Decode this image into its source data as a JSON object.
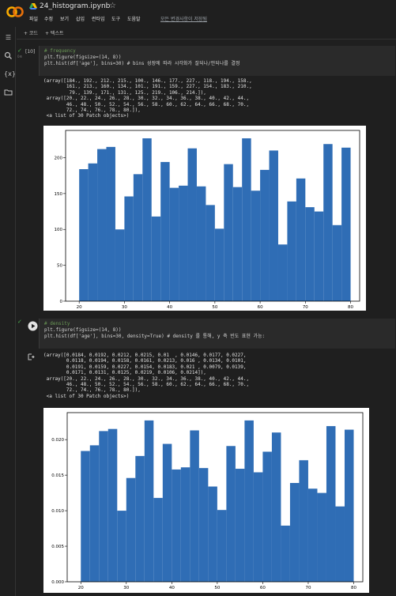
{
  "app": {
    "title": "24_histogram.ipynb",
    "star_icon": "☆",
    "menu": [
      "파일",
      "수정",
      "보기",
      "삽입",
      "런타임",
      "도구",
      "도움말"
    ],
    "saved_status": "모든 변경사항이 저장됨"
  },
  "sidebar": {
    "icons": [
      "menu-icon",
      "search-icon",
      "code-icon",
      "folder-icon"
    ]
  },
  "toolbar": {
    "add_code": "+ 코드",
    "add_text": "+ 텍스트"
  },
  "cell1": {
    "exec_count": "[10]",
    "exec_time": "0초",
    "code": [
      "# frequency",
      "plt.figure(figsize=(14, 8))",
      "plt.hist(df['age'], bins=30) # bins 성장에 따라 시각화가 잘되나/안되나를 결정"
    ],
    "output": [
      "(array([184., 192., 212., 215., 100., 146., 177., 227., 118., 194., 158.,",
      "        161., 213., 160., 134., 101., 191., 159., 227., 154., 183., 210.,",
      "         79., 139., 171., 131., 125., 219., 106., 214.]),",
      " array([20., 22., 24., 26., 28., 30., 32., 34., 36., 38., 40., 42., 44.,",
      "        46., 48., 50., 52., 54., 56., 58., 60., 62., 64., 66., 68., 70.,",
      "        72., 74., 76., 78., 80.]),",
      " <a list of 30 Patch objects>)"
    ]
  },
  "cell2": {
    "code": [
      "# density",
      "plt.figure(figsize=(14, 8))",
      "plt.hist(df['age'], bins=30, density=True) # density 를 통해, y 축 빈도 표현 가능:"
    ],
    "output": [
      "(array([0.0184, 0.0192, 0.0212, 0.0215, 0.01  , 0.0146, 0.0177, 0.0227,",
      "        0.0118, 0.0194, 0.0158, 0.0161, 0.0213, 0.016 , 0.0134, 0.0101,",
      "        0.0191, 0.0159, 0.0227, 0.0154, 0.0183, 0.021 , 0.0079, 0.0139,",
      "        0.0171, 0.0131, 0.0125, 0.0219, 0.0106, 0.0214]),",
      " array([20., 22., 24., 26., 28., 30., 32., 34., 36., 38., 40., 42., 44.,",
      "        46., 48., 50., 52., 54., 56., 58., 60., 62., 64., 66., 68., 70.,",
      "        72., 74., 76., 78., 80.]),",
      " <a list of 30 Patch objects>)"
    ]
  },
  "chart_data": [
    {
      "type": "bar",
      "title": "",
      "xlabel": "",
      "ylabel": "",
      "bin_edges": [
        20,
        22,
        24,
        26,
        28,
        30,
        32,
        34,
        36,
        38,
        40,
        42,
        44,
        46,
        48,
        50,
        52,
        54,
        56,
        58,
        60,
        62,
        64,
        66,
        68,
        70,
        72,
        74,
        76,
        78,
        80
      ],
      "values": [
        184,
        192,
        212,
        215,
        100,
        146,
        177,
        227,
        118,
        194,
        158,
        161,
        213,
        160,
        134,
        101,
        191,
        159,
        227,
        154,
        183,
        210,
        79,
        139,
        171,
        131,
        125,
        219,
        106,
        214
      ],
      "xlim": [
        17,
        82
      ],
      "ylim": [
        0,
        238
      ],
      "xticks": [
        20,
        30,
        40,
        50,
        60,
        70,
        80
      ],
      "yticks": [
        0,
        50,
        100,
        150,
        200
      ],
      "ytick_labels": [
        "0",
        "50",
        "100",
        "150",
        "200"
      ],
      "bar_color": "#2f6db5",
      "grid": false
    },
    {
      "type": "bar",
      "title": "",
      "xlabel": "",
      "ylabel": "",
      "bin_edges": [
        20,
        22,
        24,
        26,
        28,
        30,
        32,
        34,
        36,
        38,
        40,
        42,
        44,
        46,
        48,
        50,
        52,
        54,
        56,
        58,
        60,
        62,
        64,
        66,
        68,
        70,
        72,
        74,
        76,
        78,
        80
      ],
      "values": [
        0.0184,
        0.0192,
        0.0212,
        0.0215,
        0.01,
        0.0146,
        0.0177,
        0.0227,
        0.0118,
        0.0194,
        0.0158,
        0.0161,
        0.0213,
        0.016,
        0.0134,
        0.0101,
        0.0191,
        0.0159,
        0.0227,
        0.0154,
        0.0183,
        0.021,
        0.0079,
        0.0139,
        0.0171,
        0.0131,
        0.0125,
        0.0219,
        0.0106,
        0.0214
      ],
      "xlim": [
        17,
        82
      ],
      "ylim": [
        0,
        0.0238
      ],
      "xticks": [
        20,
        30,
        40,
        50,
        60,
        70,
        80
      ],
      "yticks": [
        0,
        0.005,
        0.01,
        0.015,
        0.02
      ],
      "ytick_labels": [
        "0.000",
        "0.005",
        "0.010",
        "0.015",
        "0.020"
      ],
      "bar_color": "#2f6db5",
      "grid": false
    }
  ]
}
